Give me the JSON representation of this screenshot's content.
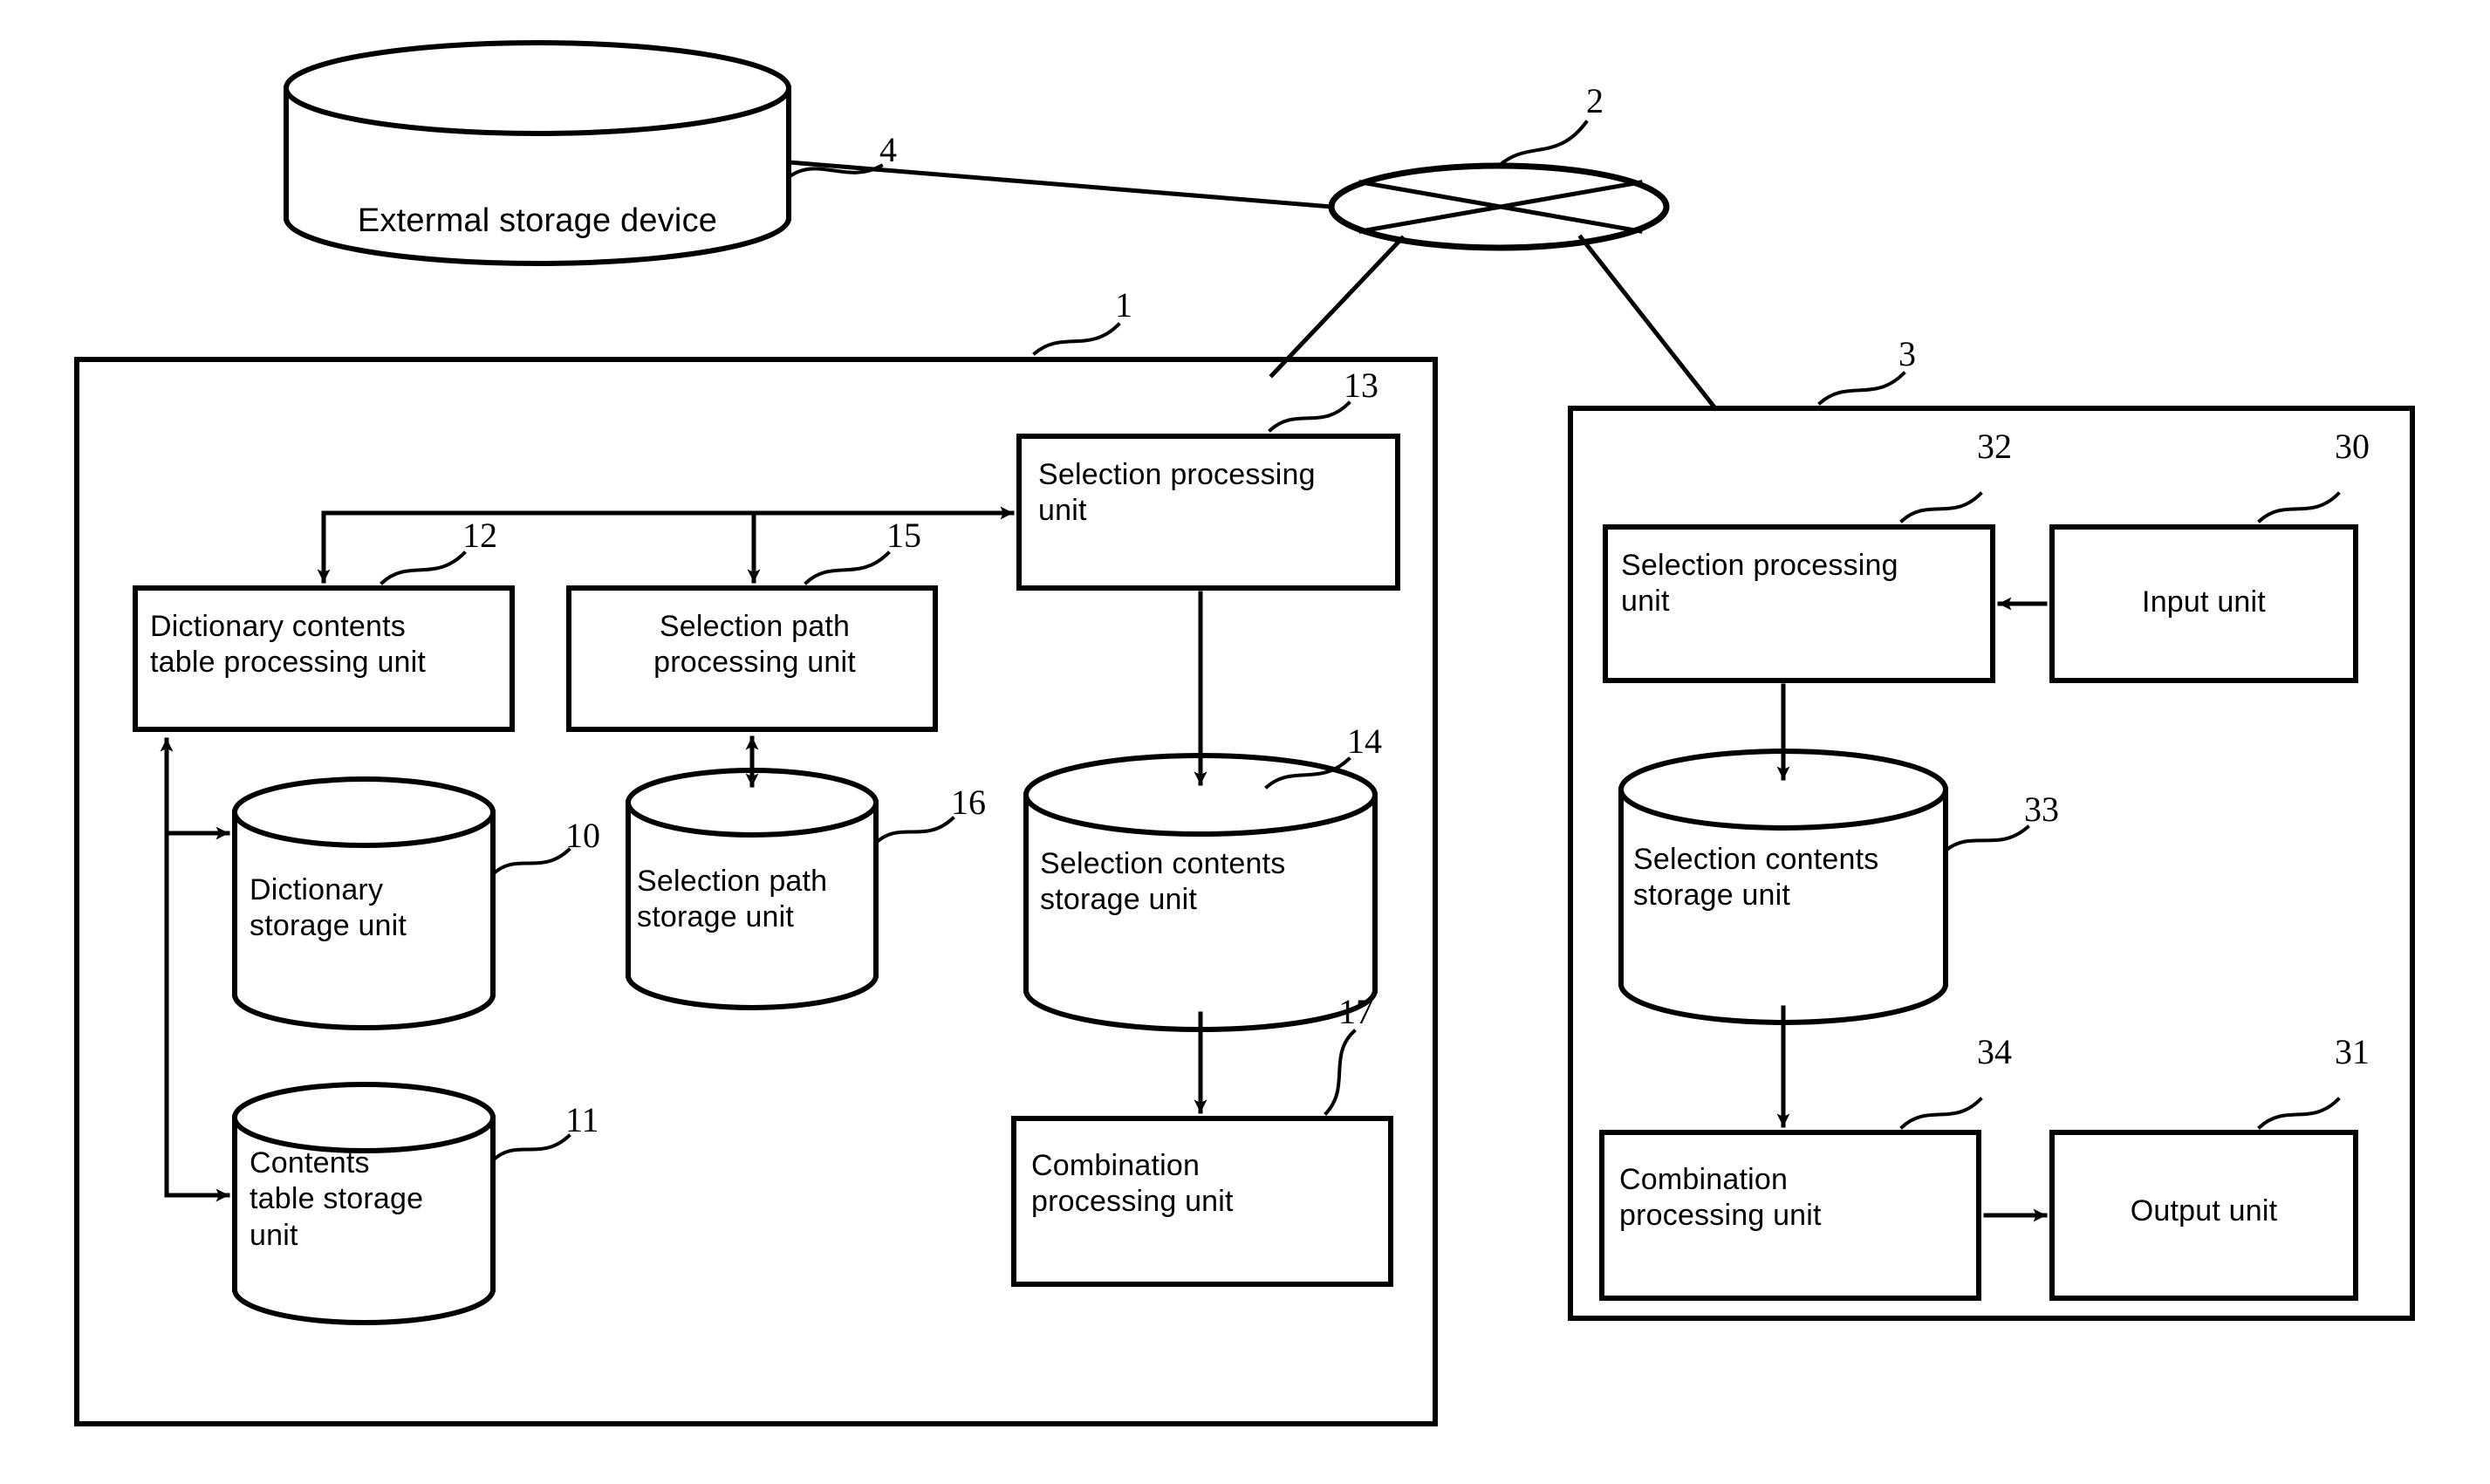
{
  "figure": {
    "kind": "patent-block-diagram",
    "stroke_color": "#000000",
    "background_color": "#ffffff"
  },
  "nodes": {
    "external_storage": {
      "label": "Extermal storage device",
      "ref": "4",
      "shape": "cylinder"
    },
    "network": {
      "label": "",
      "ref": "2",
      "shape": "ellipse-with-x"
    },
    "server_panel": {
      "label": "",
      "ref": "1",
      "shape": "rectangle"
    },
    "client_panel": {
      "label": "",
      "ref": "3",
      "shape": "rectangle"
    },
    "dictionary_contents_table_processing_unit": {
      "label": "Dictionary contents\ntable processing unit",
      "ref": "12",
      "shape": "rectangle"
    },
    "selection_path_processing_unit": {
      "label": "Selection path\nprocessing unit",
      "ref": "15",
      "shape": "rectangle"
    },
    "selection_processing_unit_server": {
      "label": "Selection  processing\nunit",
      "ref": "13",
      "shape": "rectangle"
    },
    "dictionary_storage_unit": {
      "label": "Dictionary\nstorage  unit",
      "ref": "10",
      "shape": "cylinder"
    },
    "contents_table_storage_unit": {
      "label": "Contents\ntable  storage\nunit",
      "ref": "11",
      "shape": "cylinder"
    },
    "selection_path_storage_unit": {
      "label": "Selection  path\nstorage  unit",
      "ref": "16",
      "shape": "cylinder"
    },
    "selection_contents_storage_unit_server": {
      "label": "Selection  contents\nstorage  unit",
      "ref": "14",
      "shape": "cylinder"
    },
    "combination_processing_unit_server": {
      "label": "Combination\nprocessing  unit",
      "ref": "17",
      "shape": "rectangle"
    },
    "selection_processing_unit_client": {
      "label": "Selection  processing\nunit",
      "ref": "32",
      "shape": "rectangle"
    },
    "input_unit": {
      "label": "Input  unit",
      "ref": "30",
      "shape": "rectangle"
    },
    "selection_contents_storage_unit_client": {
      "label": "Selection  contents\nstorage  unit",
      "ref": "33",
      "shape": "cylinder"
    },
    "combination_processing_unit_client": {
      "label": "Combination\nprocessing  unit",
      "ref": "34",
      "shape": "rectangle"
    },
    "output_unit": {
      "label": "Output  unit",
      "ref": "31",
      "shape": "rectangle"
    }
  },
  "reference_numerals": [
    {
      "id": "ref-4",
      "value": "4",
      "target": "external_storage"
    },
    {
      "id": "ref-2",
      "value": "2",
      "target": "network"
    },
    {
      "id": "ref-1",
      "value": "1",
      "target": "server_panel"
    },
    {
      "id": "ref-3",
      "value": "3",
      "target": "client_panel"
    },
    {
      "id": "ref-13",
      "value": "13",
      "target": "selection_processing_unit_server"
    },
    {
      "id": "ref-12",
      "value": "12",
      "target": "dictionary_contents_table_processing_unit"
    },
    {
      "id": "ref-15",
      "value": "15",
      "target": "selection_path_processing_unit"
    },
    {
      "id": "ref-14",
      "value": "14",
      "target": "selection_contents_storage_unit_server"
    },
    {
      "id": "ref-10",
      "value": "10",
      "target": "dictionary_storage_unit"
    },
    {
      "id": "ref-16",
      "value": "16",
      "target": "selection_path_storage_unit"
    },
    {
      "id": "ref-11",
      "value": "11",
      "target": "contents_table_storage_unit"
    },
    {
      "id": "ref-17",
      "value": "17",
      "target": "combination_processing_unit_server"
    },
    {
      "id": "ref-32",
      "value": "32",
      "target": "selection_processing_unit_client"
    },
    {
      "id": "ref-30",
      "value": "30",
      "target": "input_unit"
    },
    {
      "id": "ref-33",
      "value": "33",
      "target": "selection_contents_storage_unit_client"
    },
    {
      "id": "ref-34",
      "value": "34",
      "target": "combination_processing_unit_client"
    },
    {
      "id": "ref-31",
      "value": "31",
      "target": "output_unit"
    }
  ],
  "connections": [
    {
      "from": "external_storage",
      "to": "network",
      "arrow": "none"
    },
    {
      "from": "network",
      "to": "server_panel",
      "arrow": "none"
    },
    {
      "from": "network",
      "to": "client_panel",
      "arrow": "none"
    },
    {
      "from": "bus",
      "to": "dictionary_contents_table_processing_unit",
      "arrow": "single"
    },
    {
      "from": "bus",
      "to": "selection_path_processing_unit",
      "arrow": "single"
    },
    {
      "from": "bus",
      "to": "selection_processing_unit_server",
      "arrow": "single"
    },
    {
      "from": "dictionary_storage_unit",
      "to": "dictionary_contents_table_processing_unit",
      "arrow": "single"
    },
    {
      "from": "contents_table_storage_unit",
      "to": "dictionary_contents_table_processing_unit",
      "arrow": "single"
    },
    {
      "from": "selection_path_processing_unit",
      "to": "selection_path_storage_unit",
      "arrow": "double"
    },
    {
      "from": "selection_processing_unit_server",
      "to": "selection_contents_storage_unit_server",
      "arrow": "single"
    },
    {
      "from": "selection_contents_storage_unit_server",
      "to": "combination_processing_unit_server",
      "arrow": "single"
    },
    {
      "from": "input_unit",
      "to": "selection_processing_unit_client",
      "arrow": "single"
    },
    {
      "from": "selection_processing_unit_client",
      "to": "selection_contents_storage_unit_client",
      "arrow": "single"
    },
    {
      "from": "selection_contents_storage_unit_client",
      "to": "combination_processing_unit_client",
      "arrow": "single"
    },
    {
      "from": "combination_processing_unit_client",
      "to": "output_unit",
      "arrow": "single"
    }
  ]
}
